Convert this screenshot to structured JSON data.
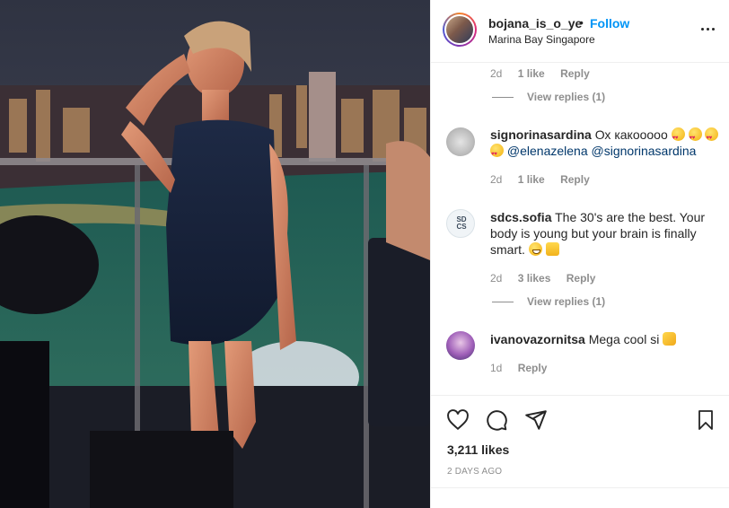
{
  "post": {
    "username": "bojana_is_o_ye",
    "separator": "•",
    "follow_label": "Follow",
    "location": "Marina Bay Singapore"
  },
  "comments": [
    {
      "type": "meta-only",
      "time": "2d",
      "likes": "1 like",
      "reply_label": "Reply",
      "view_replies": "View replies (1)"
    },
    {
      "username": "signorinasardina",
      "text": "Ох какооооо",
      "mentions": [
        "@elenazelena",
        "@signorinasardina"
      ],
      "emojis": [
        "heart-eyes-emoji",
        "heart-eyes-emoji",
        "heart-eyes-emoji",
        "heart-eyes-emoji"
      ],
      "time": "2d",
      "likes": "1 like",
      "reply_label": "Reply"
    },
    {
      "username": "sdcs.sofia",
      "avatar_text": "SD CS",
      "text": "The 30's are the best. Your body is young but your brain is finally smart.",
      "emojis": [
        "grin-emoji",
        "thumbs-up-emoji"
      ],
      "time": "2d",
      "likes": "3 likes",
      "reply_label": "Reply",
      "view_replies": "View replies (1)"
    },
    {
      "username": "ivanovazornitsa",
      "text": "Mega cool si",
      "emojis": [
        "clapping-hands-emoji"
      ],
      "time": "1d",
      "reply_label": "Reply"
    }
  ],
  "actions": {
    "icons": [
      "heart-icon",
      "comment-icon",
      "share-icon",
      "bookmark-icon"
    ],
    "likes": "3,211 likes",
    "date": "2 DAYS AGO"
  },
  "colors": {
    "link": "#0095f6",
    "text": "#262626",
    "muted": "#8e8e8e",
    "border": "#efefef"
  }
}
